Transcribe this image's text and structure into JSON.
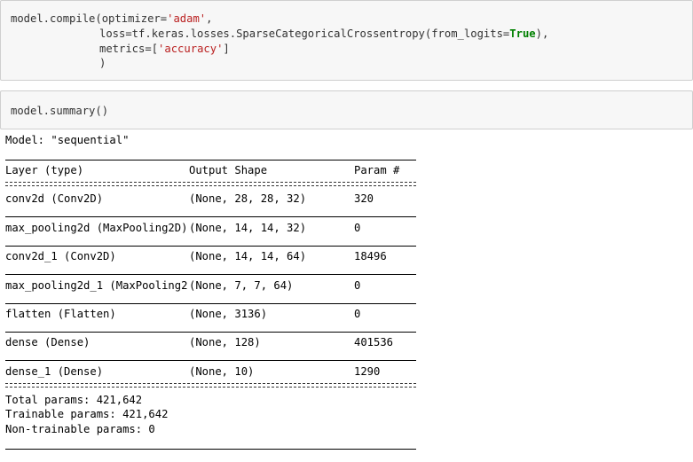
{
  "compile_cell": {
    "line1_prefix": "model.compile(optimizer=",
    "line1_str": "'adam'",
    "line1_suffix": ",",
    "line2_prefix": "loss=tf.keras.losses.SparseCategoricalCrossentropy(from_logits=",
    "line2_true": "True",
    "line2_suffix": "),",
    "line3_prefix": "metrics=[",
    "line3_str": "'accuracy'",
    "line3_suffix": "]",
    "line4": ")"
  },
  "summary_cell": {
    "code_prefix": "model.summary",
    "code_parens": "()"
  },
  "output": {
    "model_line": "Model: \"sequential\"",
    "headers": {
      "layer": "Layer (type)",
      "output_shape": "Output Shape",
      "params": "Param #"
    },
    "rows": [
      {
        "layer": "conv2d (Conv2D)",
        "shape": "(None, 28, 28, 32)",
        "params": "320"
      },
      {
        "layer": "max_pooling2d (MaxPooling2D)",
        "shape": "(None, 14, 14, 32)",
        "params": "0"
      },
      {
        "layer": "conv2d_1 (Conv2D)",
        "shape": "(None, 14, 14, 64)",
        "params": "18496"
      },
      {
        "layer": "max_pooling2d_1 (MaxPooling2",
        "shape": "(None, 7, 7, 64)",
        "params": "0"
      },
      {
        "layer": "flatten (Flatten)",
        "shape": "(None, 3136)",
        "params": "0"
      },
      {
        "layer": "dense (Dense)",
        "shape": "(None, 128)",
        "params": "401536"
      },
      {
        "layer": "dense_1 (Dense)",
        "shape": "(None, 10)",
        "params": "1290"
      }
    ],
    "total_params": "Total params: 421,642",
    "trainable_params": "Trainable params: 421,642",
    "non_trainable_params": "Non-trainable params: 0"
  }
}
